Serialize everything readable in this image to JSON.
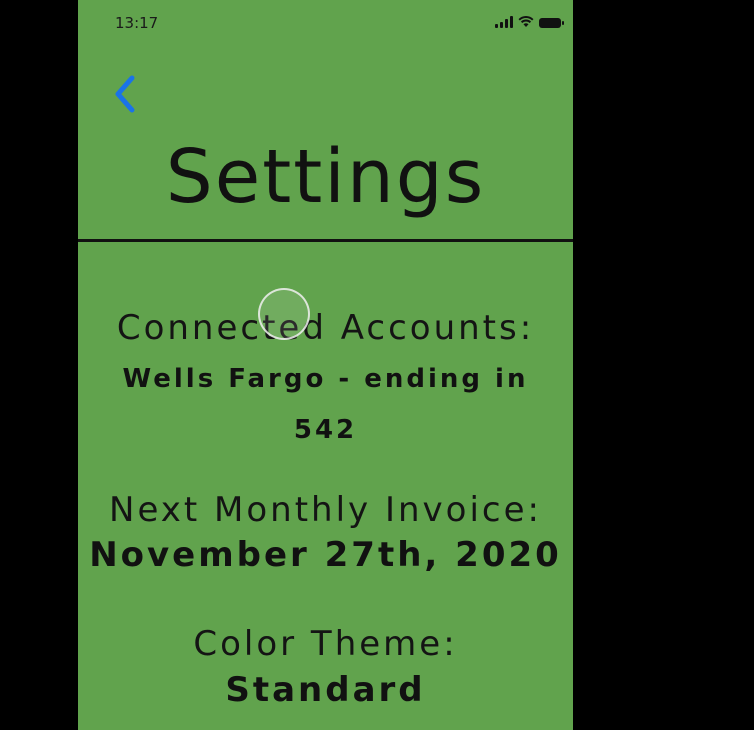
{
  "status_bar": {
    "time": "13:17",
    "icons": [
      "signal-icon",
      "wifi-icon",
      "battery-icon"
    ]
  },
  "header": {
    "back_icon": "chevron-left-icon",
    "back_color": "#1a73e8",
    "title": "Settings"
  },
  "settings": {
    "connected_accounts": {
      "label": "Connected Accounts:",
      "value_line1": "Wells Fargo - ending in",
      "value_line2": "542"
    },
    "next_invoice": {
      "label": "Next Monthly Invoice:",
      "value": "November 27th, 2020"
    },
    "color_theme": {
      "label": "Color Theme:",
      "value": "Standard"
    }
  },
  "colors": {
    "background": "#61a34d",
    "outer": "#000000",
    "text": "#111111"
  }
}
